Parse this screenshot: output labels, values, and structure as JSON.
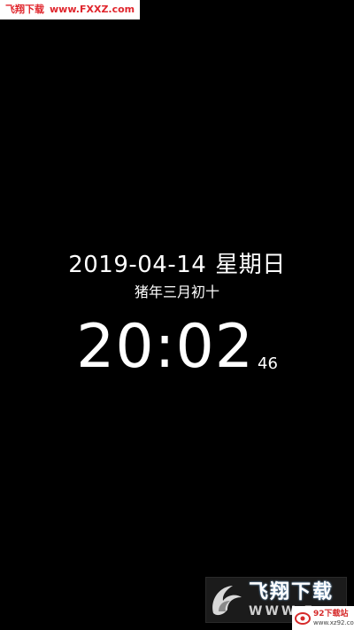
{
  "watermark_top": {
    "brand": "飞翔下载",
    "url": "www.FXXZ.com"
  },
  "clock": {
    "date": "2019-04-14",
    "weekday": "星期日",
    "lunar": "猪年三月初十",
    "time": "20:02",
    "seconds": "46"
  },
  "watermark_logo": {
    "cn": "飞翔下载",
    "en": "WWW.F"
  },
  "watermark_92": {
    "name": "92下载站",
    "domain": "www.xz92.com"
  },
  "colors": {
    "background": "#000000",
    "text": "#ffffff",
    "watermark_red": "#e0262d"
  }
}
